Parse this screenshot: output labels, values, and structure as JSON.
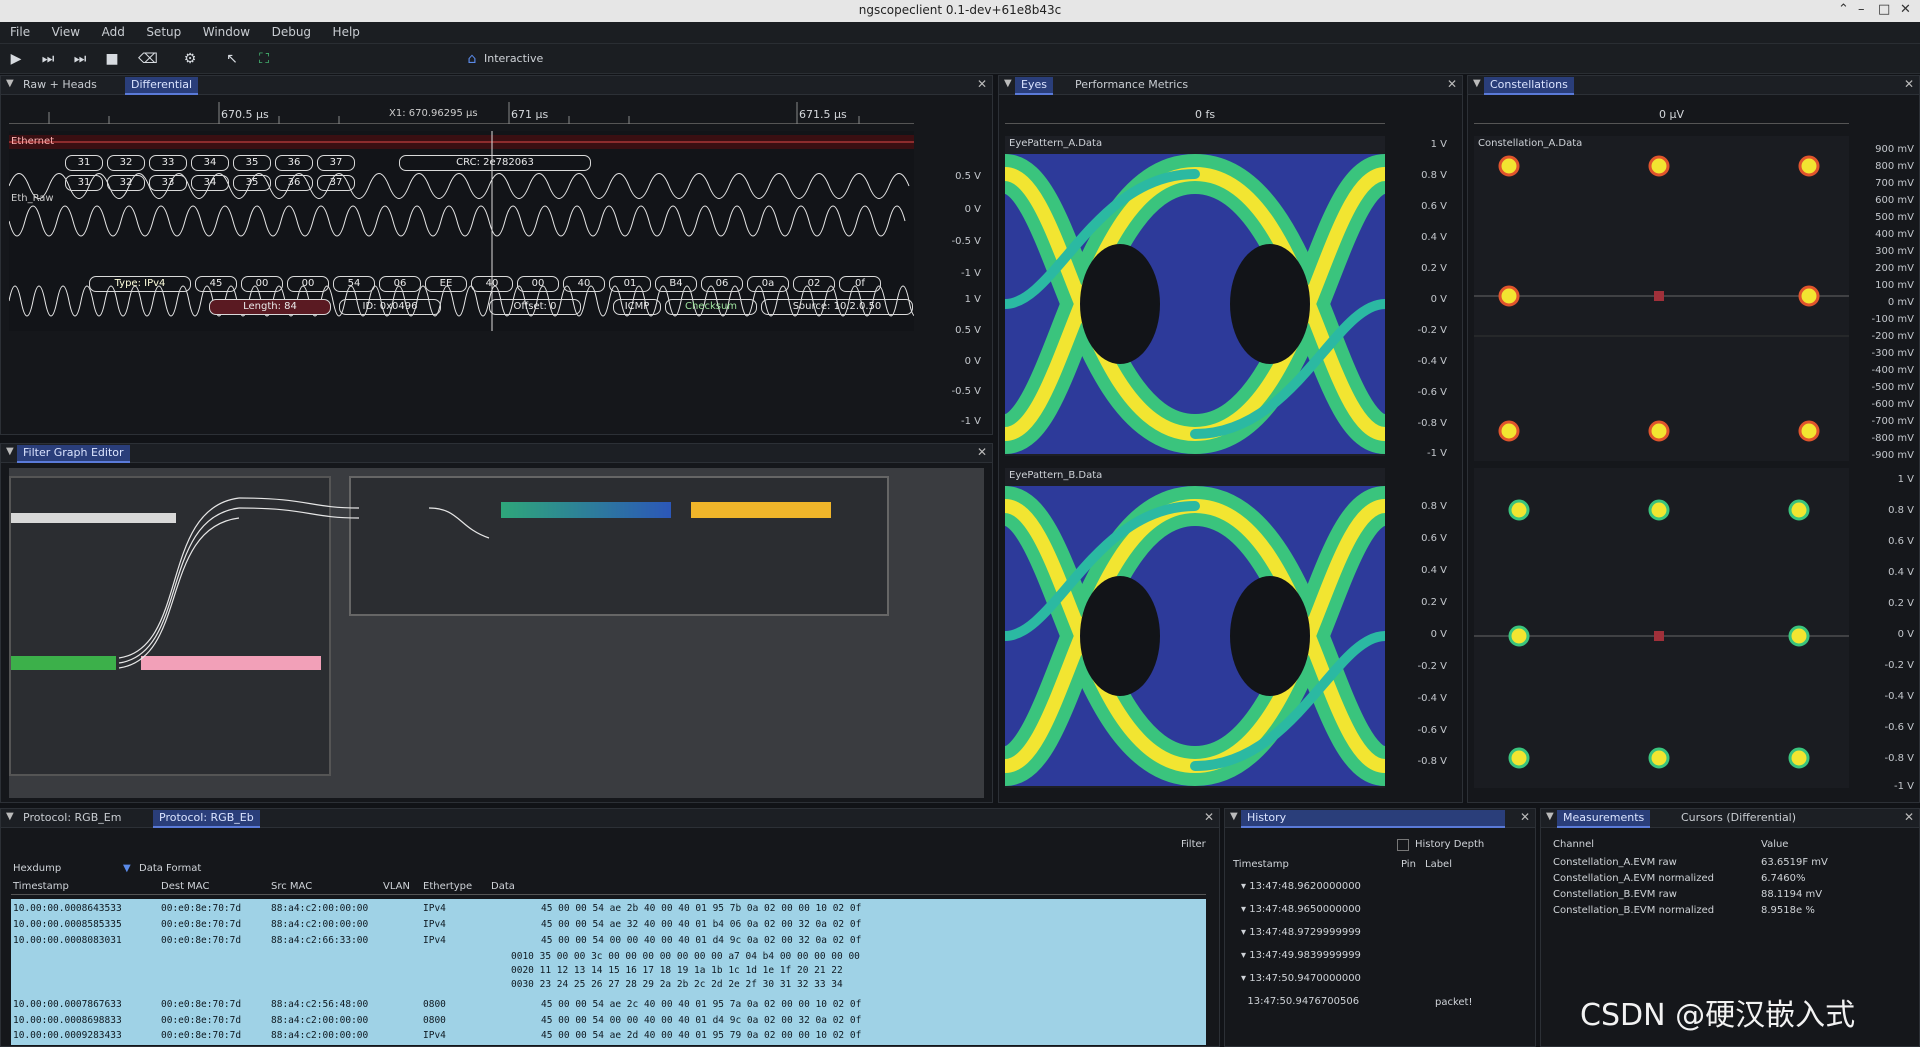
{
  "window": {
    "title": "ngscopeclient 0.1-dev+61e8b43c"
  },
  "menu": [
    "File",
    "View",
    "Add",
    "Setup",
    "Window",
    "Debug",
    "Help"
  ],
  "toolbar": {
    "interactive_label": "Interactive"
  },
  "waveform_panel": {
    "tabs": [
      "Raw + Heads",
      "Differential"
    ],
    "time_ticks": [
      "670.5 µs",
      "671 µs",
      "671.5 µs"
    ],
    "cursor_label": "X1: 670.96295 µs",
    "channel_labels": [
      "Ethernet",
      "Eth_Raw",
      "Eth_Raw"
    ],
    "crc": "CRC: 2e782063",
    "symbols_a": [
      "31",
      "32",
      "33",
      "34",
      "35",
      "36",
      "37"
    ],
    "symbols_b": [
      "31",
      "32",
      "33",
      "34",
      "35",
      "36",
      "37"
    ],
    "proto_fields": [
      "Type: IPv4",
      "45",
      "00",
      "00",
      "54",
      "06",
      "EE",
      "40",
      "00",
      "40",
      "01",
      "B4",
      "06",
      "0a",
      "02",
      "0f"
    ],
    "proto_fields2": [
      "Length: 84",
      "ID: 0x0496",
      "Offset: 0",
      "ICMP",
      "Checksum",
      "Source: 10.2.0.50"
    ],
    "y_labels_top": [
      "0.5 V",
      "0 V",
      "-0.5 V",
      "-1 V"
    ],
    "y_labels_bottom": [
      "1 V",
      "0.5 V",
      "0 V",
      "-0.5 V",
      "-1 V"
    ]
  },
  "filter_graph_panel": {
    "tabs": [
      "Filter Graph Editor"
    ]
  },
  "eye_panel": {
    "tabs": [
      "Eyes",
      "Performance Metrics"
    ],
    "time_tick": "0 fs",
    "eye_a_title": "EyePattern_A.Data",
    "eye_b_title": "EyePattern_B.Data",
    "y_labels_a": [
      "1 V",
      "0.8 V",
      "0.6 V",
      "0.4 V",
      "0.2 V",
      "0 V",
      "-0.2 V",
      "-0.4 V",
      "-0.6 V",
      "-0.8 V",
      "-1 V"
    ],
    "y_labels_b": [
      "0.8 V",
      "0.6 V",
      "0.4 V",
      "0.2 V",
      "0 V",
      "-0.2 V",
      "-0.4 V",
      "-0.6 V",
      "-0.8 V"
    ]
  },
  "constellation_panel": {
    "tabs": [
      "Constellations"
    ],
    "top_tick": "0 µV",
    "title_a": "Constellation_A.Data",
    "y_labels_a": [
      "900 mV",
      "800 mV",
      "700 mV",
      "600 mV",
      "500 mV",
      "400 mV",
      "300 mV",
      "200 mV",
      "100 mV",
      "0 mV",
      "-100 mV",
      "-200 mV",
      "-300 mV",
      "-400 mV",
      "-500 mV",
      "-600 mV",
      "-700 mV",
      "-800 mV",
      "-900 mV"
    ],
    "y_labels_b": [
      "1 V",
      "0.8 V",
      "0.6 V",
      "0.4 V",
      "0.2 V",
      "0 V",
      "-0.2 V",
      "-0.4 V",
      "-0.6 V",
      "-0.8 V",
      "-1 V"
    ]
  },
  "protocol_panel": {
    "tabs": [
      "Protocol: RGB_Em",
      "Protocol: RGB_Eb"
    ],
    "filter_label": "Filter",
    "hexdump_label": "Hexdump",
    "data_format_label": "Data Format",
    "columns": [
      "Timestamp",
      "Dest MAC",
      "Src MAC",
      "VLAN",
      "Ethertype",
      "Data"
    ],
    "rows": [
      {
        "ts": "10.00:00.0008643533",
        "dst": "00:e0:8e:70:7d",
        "src": "88:a4:c2:00:00:00",
        "vlan": "",
        "et": "IPv4",
        "data": "45 00 00 54 ae 2b 40 00 40 01 95 7b 0a 02 00 00 10 02 0f"
      },
      {
        "ts": "10.00:00.0008585335",
        "dst": "00:e0:8e:70:7d",
        "src": "88:a4:c2:00:00:00",
        "vlan": "",
        "et": "IPv4",
        "data": "45 00 00 54 ae 32 40 00 40 01 b4 06 0a 02 00 32 0a 02 0f"
      },
      {
        "ts": "10.00:00.0008083031",
        "dst": "00:e0:8e:70:7d",
        "src": "88:a4:c2:66:33:00",
        "vlan": "",
        "et": "IPv4",
        "data": "45 00 00 54 00 00 40 00 40 01 d4 9c 0a 02 00 32 0a 02 0f"
      },
      {
        "ts": "",
        "dst": "",
        "src": "",
        "vlan": "",
        "et": "",
        "data": "0010 35 00 00 3c 00 00 00 00 00 00 00 a7 04 b4 00 00 00 00 00"
      },
      {
        "ts": "",
        "dst": "",
        "src": "",
        "vlan": "",
        "et": "",
        "data": "0020 11 12 13 14 15 16 17 18 19 1a 1b 1c 1d 1e 1f 20 21 22"
      },
      {
        "ts": "",
        "dst": "",
        "src": "",
        "vlan": "",
        "et": "",
        "data": "0030 23 24 25 26 27 28 29 2a 2b 2c 2d 2e 2f 30 31 32 33 34"
      },
      {
        "ts": "10.00:00.0007867633",
        "dst": "00:e0:8e:70:7d",
        "src": "88:a4:c2:56:48:00",
        "vlan": "",
        "et": "0800",
        "data": "45 00 00 54 ae 2c 40 00 40 01 95 7a 0a 02 00 00 10 02 0f"
      },
      {
        "ts": "10.00:00.0008698833",
        "dst": "00:e0:8e:70:7d",
        "src": "88:a4:c2:00:00:00",
        "vlan": "",
        "et": "0800",
        "data": "45 00 00 54 00 00 40 00 40 01 d4 9c 0a 02 00 32 0a 02 0f"
      },
      {
        "ts": "10.00:00.0009283433",
        "dst": "00:e0:8e:70:7d",
        "src": "88:a4:c2:00:00:00",
        "vlan": "",
        "et": "IPv4",
        "data": "45 00 00 54 ae 2d 40 00 40 01 95 79 0a 02 00 00 10 02 0f"
      }
    ]
  },
  "history_panel": {
    "tabs": [
      "History"
    ],
    "history_depth_label": "History Depth",
    "pin_label": "Pin",
    "label_col": "Label",
    "timestamp_col": "Timestamp",
    "entries": [
      "13:47:48.9620000000",
      "13:47:48.9650000000",
      "13:47:48.9729999999",
      "13:47:49.9839999999",
      "13:47:50.9470000000",
      "13:47:50.9476700506"
    ],
    "note": "packet!"
  },
  "measurements_panel": {
    "tabs": [
      "Measurements",
      "Cursors (Differential)"
    ],
    "columns": [
      "Channel",
      "Value"
    ],
    "rows": [
      {
        "channel": "Constellation_A.EVM raw",
        "value": "63.6519F mV"
      },
      {
        "channel": "Constellation_A.EVM normalized",
        "value": "6.7460%"
      },
      {
        "channel": "Constellation_B.EVM raw",
        "value": "88.1194 mV"
      },
      {
        "channel": "Constellation_B.EVM normalized",
        "value": "8.9518e %"
      }
    ]
  },
  "watermark": "CSDN @硬汉嵌入式",
  "colors": {
    "accent": "#2a3e7a",
    "row_bg": "#9fd2e6",
    "eye_yellow": "#f2e531",
    "eye_green": "#3ac47d",
    "eye_blue": "#2d3a9a"
  }
}
